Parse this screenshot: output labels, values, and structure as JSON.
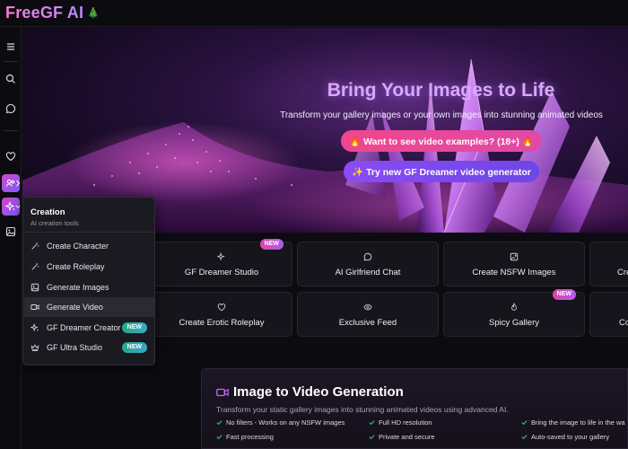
{
  "brand": {
    "name": "FreeGF AI",
    "badge": "🎄"
  },
  "hero": {
    "title": "Bring Your Images to Life",
    "subtitle": "Transform your gallery images or your own images into stunning animated videos",
    "examples_button": "🔥 Want to see video examples? (18+) 🔥",
    "dreamer_button": "✨ Try new GF Dreamer video generator"
  },
  "cards": [
    {
      "label": "GF Dreamer Studio",
      "icon": "sparkles-icon",
      "badge": "NEW"
    },
    {
      "label": "AI Girlfriend Chat",
      "icon": "chat-icon",
      "badge": ""
    },
    {
      "label": "Create NSFW Images",
      "icon": "image-plus-icon",
      "badge": ""
    },
    {
      "label": "Cre",
      "icon": "sparkle-icon",
      "badge": ""
    },
    {
      "label": "Create Erotic Roleplay",
      "icon": "heart-icon",
      "badge": ""
    },
    {
      "label": "Exclusive Feed",
      "icon": "eye-icon",
      "badge": ""
    },
    {
      "label": "Spicy Gallery",
      "icon": "flame-icon",
      "badge": "NEW"
    },
    {
      "label": "Co",
      "icon": "spark-icon",
      "badge": ""
    }
  ],
  "menu": {
    "title": "Creation",
    "subtitle": "AI creation tools",
    "items": [
      {
        "label": "Create Character",
        "icon": "wand-icon",
        "badge": ""
      },
      {
        "label": "Create Roleplay",
        "icon": "wand-icon",
        "badge": ""
      },
      {
        "label": "Generate Images",
        "icon": "image-icon",
        "badge": ""
      },
      {
        "label": "Generate Video",
        "icon": "video-icon",
        "badge": ""
      },
      {
        "label": "GF Dreamer Creator",
        "icon": "sparkles-icon",
        "badge": "NEW"
      },
      {
        "label": "GF Ultra Studio",
        "icon": "crown-icon",
        "badge": "NEW"
      }
    ]
  },
  "feature": {
    "title": "Image to Video Generation",
    "subtitle": "Transform your static gallery images into stunning animated videos using advanced AI.",
    "points": [
      "No filters - Works on any NSFW images",
      "Full HD resolution",
      "Bring the image to life in the wa",
      "Fast processing",
      "Private and secure",
      "Auto-saved to your gallery"
    ]
  },
  "colors": {
    "accent": "#d246c8",
    "accent2": "#7b5cff",
    "check": "#3ecf8e"
  }
}
